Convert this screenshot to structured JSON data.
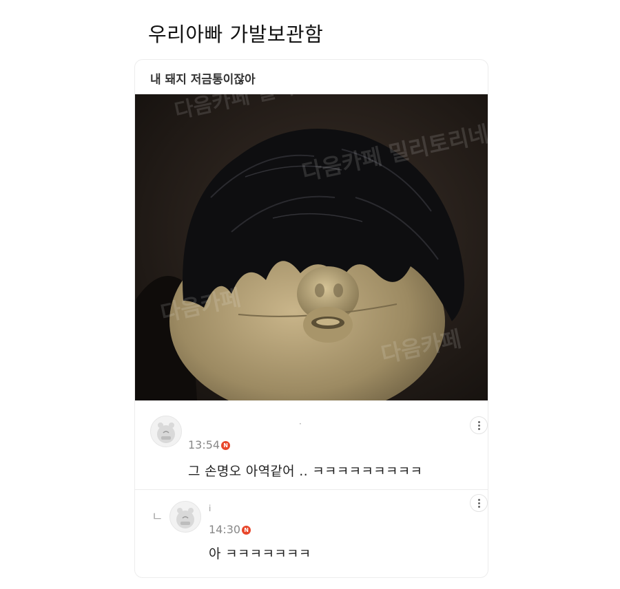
{
  "post": {
    "title": "우리아빠 가발보관함"
  },
  "card": {
    "header": "내 돼지 저금통이잖아"
  },
  "photo": {
    "watermark_1": "다음카페 밀리토리네",
    "watermark_2": "다음카페"
  },
  "comments": [
    {
      "nickname": "·",
      "time": "13:54",
      "badge": "N",
      "text": "그 손명오 아역같어 .. ㅋㅋㅋㅋㅋㅋㅋㅋㅋ",
      "reply_mark": ""
    },
    {
      "nickname": "i",
      "time": "14:30",
      "badge": "N",
      "text": "아 ㅋㅋㅋㅋㅋㅋㅋ",
      "reply_mark": "ㄴ"
    }
  ],
  "colors": {
    "badge": "#e8462a",
    "border": "#ececec",
    "time": "#888888"
  },
  "icons": {
    "more": "more-vertical-icon",
    "avatar": "default-avatar-icon",
    "reply": "reply-arrow-icon"
  }
}
